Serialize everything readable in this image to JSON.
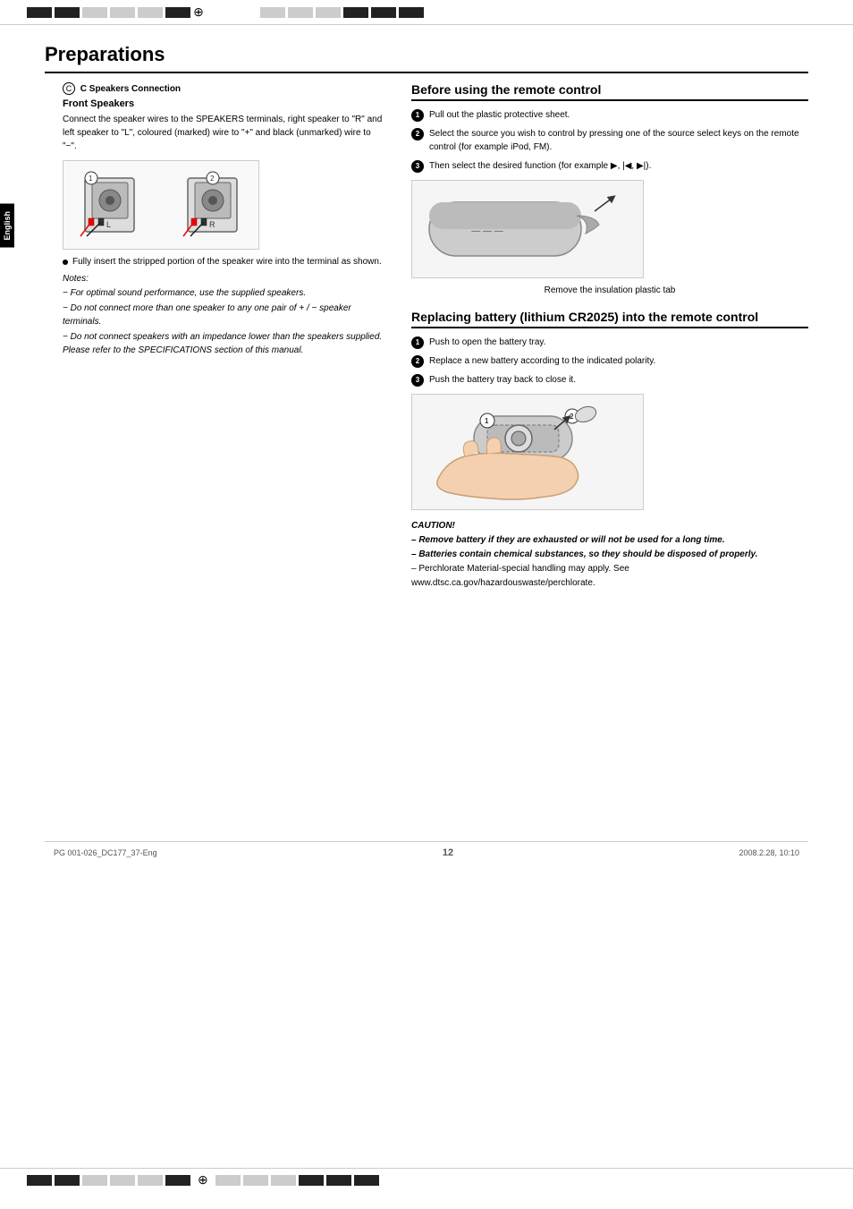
{
  "page": {
    "title": "Preparations",
    "number": "12",
    "footer_left": "PG 001-026_DC177_37-Eng",
    "footer_center": "12",
    "footer_right": "2008.2.28, 10:10"
  },
  "english_tab": "English",
  "left_column": {
    "section_label": "C  Speakers Connection",
    "subsection_title": "Front Speakers",
    "body_text_1": "Connect the speaker wires to the SPEAKERS terminals, right speaker to \"R\" and left speaker to \"L\", coloured (marked) wire to \"+\" and black (unmarked) wire to \"−\".",
    "bullet_1": "Fully insert the stripped portion of the speaker wire into the terminal as shown.",
    "notes_title": "Notes:",
    "notes": [
      "− For optimal sound performance, use the supplied speakers.",
      "− Do not connect more than one speaker to any one pair of + / − speaker terminals.",
      "− Do not connect speakers with an impedance lower than the speakers supplied. Please refer to the SPECIFICATIONS section of this manual."
    ]
  },
  "right_column": {
    "section1_title": "Before using the remote control",
    "step1": "Pull out the plastic protective sheet.",
    "step2": "Select the source you wish to control by pressing one of the source select keys on the remote control (for example iPod, FM).",
    "step3": "Then select the desired function (for example ▶, |◀, ▶|).",
    "image1_caption": "Remove the insulation plastic tab",
    "section2_title": "Replacing battery (lithium CR2025) into the remote control",
    "bstep1": "Push to open the battery tray.",
    "bstep2": "Replace a new battery according to the indicated polarity.",
    "bstep3": "Push the battery tray back to close it.",
    "caution_title": "CAUTION!",
    "caution_items": [
      "– Remove battery if they are exhausted or will not be used for a long time.",
      "– Batteries contain chemical substances, so they should be disposed of properly.",
      "– Perchlorate Material-special handling may apply. See www.dtsc.ca.gov/hazardouswaste/perchlorate."
    ]
  }
}
